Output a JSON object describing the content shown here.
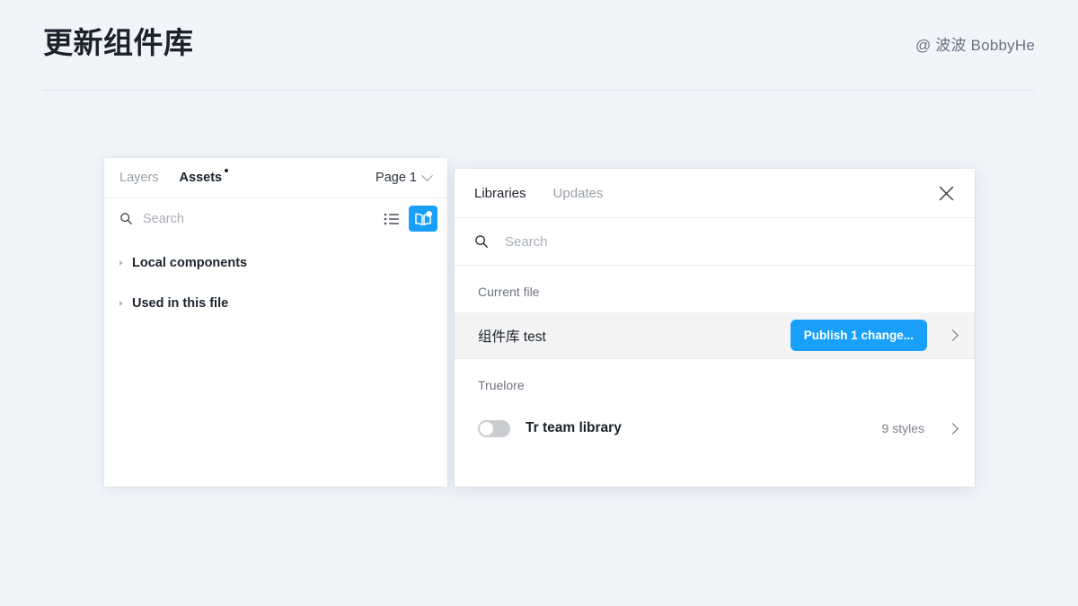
{
  "page": {
    "title": "更新组件库",
    "author": "@ 波波 BobbyHe",
    "background_color": "#f1f5fa",
    "accent_color": "#19a0fb"
  },
  "assets_panel": {
    "tabs": [
      {
        "label": "Layers",
        "active": false
      },
      {
        "label": "Assets",
        "active": true,
        "has_dot": true
      }
    ],
    "page_selector": {
      "label": "Page 1",
      "icon": "chevron-down-icon"
    },
    "search": {
      "placeholder": "Search",
      "value": "",
      "icon": "search-icon"
    },
    "toolbar": {
      "list_view_icon": "list-view-icon",
      "library_icon": "book-library-icon",
      "library_badge": true
    },
    "tree": [
      {
        "label": "Local components",
        "expanded": false
      },
      {
        "label": "Used in this file",
        "expanded": false
      }
    ]
  },
  "libraries_panel": {
    "tabs": [
      {
        "label": "Libraries",
        "active": true
      },
      {
        "label": "Updates",
        "active": false
      }
    ],
    "close_icon": "close-icon",
    "search": {
      "placeholder": "Search",
      "value": "",
      "icon": "search-icon"
    },
    "sections": [
      {
        "label": "Current file",
        "rows": [
          {
            "name": "组件库 test",
            "highlighted": true,
            "action_label": "Publish 1 change...",
            "chevron": "chevron-right-icon"
          }
        ]
      },
      {
        "label": "Truelore",
        "rows": [
          {
            "name": "Tr team library",
            "toggle_on": false,
            "meta": "9 styles",
            "chevron": "chevron-right-icon"
          }
        ]
      }
    ]
  }
}
